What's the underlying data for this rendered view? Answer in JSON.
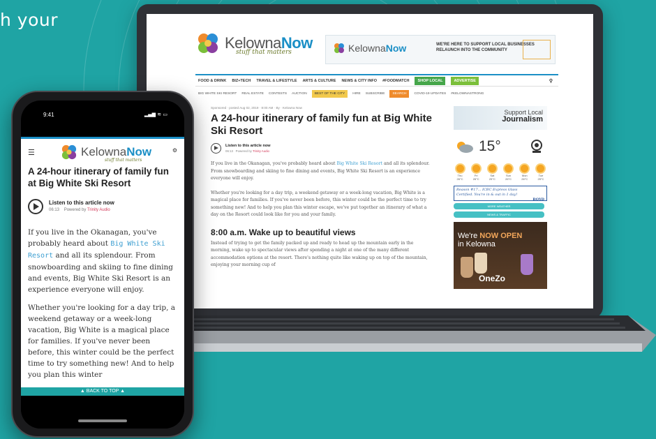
{
  "background": {
    "color": "#1fa4a4",
    "headline_fragment": "h your"
  },
  "desktop": {
    "logo": {
      "brand_a": "Kelowna",
      "brand_b": "Now",
      "tagline": "stuff that matters"
    },
    "banner": {
      "brand_a": "Kelowna",
      "brand_b": "Now",
      "text_line1": "WE'RE HERE TO SUPPORT LOCAL BUSINESSES",
      "text_line2": "RELAUNCH INTO THE COMMUNITY"
    },
    "nav_primary": [
      "FOOD & DRINK",
      "BIZ+TECH",
      "TRAVEL & LIFESTYLE",
      "ARTS & CULTURE",
      "NEWS & CITY INFO",
      "#FOODMATCH",
      "SHOP LOCAL",
      "ADVERTISE"
    ],
    "nav_secondary": [
      "BIG WHITE SKI RESORT",
      "REAL ESTATE",
      "CONTESTS",
      "AUCTION",
      "BEST OF THE CITY",
      "HIRE",
      "SUBSCRIBE",
      "SEARCH",
      "COVID-19 UPDATES",
      "#KELOWNASTRONG"
    ],
    "article": {
      "meta": "Sponsored · posted Aug 02, 2019 · 8:00 AM · By · Kelowna Now",
      "title": "A 24-hour itinerary of family fun at Big White Ski Resort",
      "listen_title": "Listen to this article now",
      "listen_time": "06:13",
      "listen_powered": "Powered by",
      "listen_brand": "Trinity Audio",
      "p1_before": "If you live in the Okanagan, you've probably heard about ",
      "p1_link": "Big White Ski Resort",
      "p1_after": " and all its splendour. From snowboarding and skiing to fine dining and events, Big White Ski Resort is an experience everyone will enjoy.",
      "p2": "Whether you're looking for a day trip, a weekend getaway or a week-long vacation, Big White is a magical place for families. If you've never been before, this winter could be the perfect time to try something new! And to help you plan this winter escape, we've put together an itinerary of what a day on the Resort could look like for you and your family.",
      "h2": "8:00 a.m. Wake up to beautiful views",
      "p3": "Instead of trying to get the family packed up and ready to head up the mountain early in the morning, wake up to spectacular views after spending a night at one of the many different accommodation options at the resort. There's nothing quite like waking up on top of the mountain, enjoying your morning cup of"
    },
    "sidebar": {
      "support_l1": "Support Local",
      "support_l2": "Journalism",
      "temp": "15°",
      "days": [
        "Thu",
        "Fri",
        "Sat",
        "Sun",
        "Mon",
        "Tue"
      ],
      "day_temps": [
        "26°C",
        "26°C",
        "25°C",
        "26°C",
        "26°C",
        "25°C"
      ],
      "ad1_l1": "Reason #17... ICBC Express Glass",
      "ad1_l2": "Certified. You're in & out in 1 day!",
      "ad1_brand": "BOYD",
      "btn1": "MORE WEATHER",
      "btn2": "NEWS & TRAFFIC",
      "ad2_l1": "We're ",
      "ad2_hl": "NOW OPEN",
      "ad2_l2": "in Kelowna",
      "ad2_brand": "OneZo"
    }
  },
  "phone": {
    "time": "9:41",
    "status_icons": "▂▄▆ ≋ ▭",
    "logo": {
      "brand_a": "Kelowna",
      "brand_b": "Now",
      "tagline": "stuff that matters"
    },
    "title": "A 24-hour itinerary of family fun at Big White Ski Resort",
    "listen_title": "Listen to this article now",
    "listen_time": "06:13",
    "listen_powered": "Powered by",
    "listen_brand": "Trinity Audio",
    "p1_before": "If you live in the Okanagan, you've probably heard about ",
    "p1_link": "Big White Ski Resort",
    "p1_after": " and all its splendour. From snowboarding and skiing to fine dining and events, Big White Ski Resort is an experience everyone will enjoy.",
    "p2": "Whether you're looking for a day trip, a weekend getaway or a week-long vacation, Big White is a magical place for families. If you've never been before, this winter could be the perfect time to try something new! And to help you plan this winter",
    "back_to_top": "▲ BACK TO TOP ▲"
  }
}
